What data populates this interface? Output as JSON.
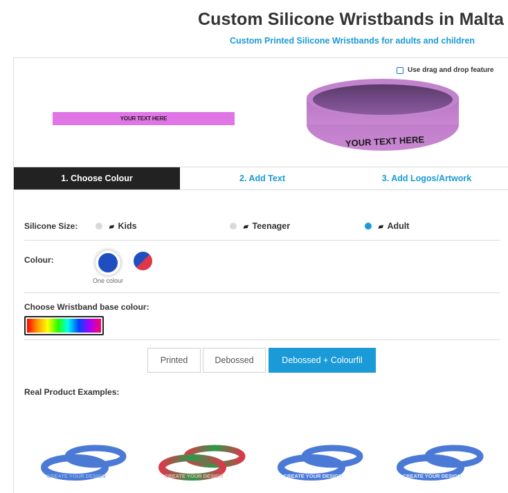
{
  "header": {
    "title": "Custom Silicone Wristbands in Malta",
    "subtitle": "Custom Printed Silicone Wristbands for adults and children"
  },
  "preview": {
    "drag_drop_label": "Use drag and drop feature",
    "drag_drop_checked": false,
    "flat_band_text": "YOUR TEXT HERE",
    "band_3d_text": "YOUR TEXT HERE",
    "band_colour": "#e075e6"
  },
  "tabs": [
    {
      "label": "1. Choose Colour",
      "active": true
    },
    {
      "label": "2. Add Text",
      "active": false
    },
    {
      "label": "3. Add Logos/Artwork",
      "active": false
    }
  ],
  "size": {
    "label": "Silicone Size:",
    "options": [
      {
        "label": "Kids",
        "selected": false
      },
      {
        "label": "Teenager",
        "selected": false
      },
      {
        "label": "Adult",
        "selected": true
      }
    ]
  },
  "colour": {
    "label": "Colour:",
    "one_colour_caption": "One colour",
    "selected": "one"
  },
  "base_colour": {
    "label": "Choose Wristband base colour:"
  },
  "style_buttons": [
    {
      "label": "Printed",
      "active": false
    },
    {
      "label": "Debossed",
      "active": false
    },
    {
      "label": "Debossed + Colourfil",
      "active": true
    }
  ],
  "examples": {
    "label": "Real Product Examples:",
    "band_text": "CREATE YOUR DESIGN"
  },
  "colors": {
    "accent": "#1a9ad6",
    "tab_active_bg": "#222222",
    "example_blue": "#4a7ad6",
    "example_red": "#d83a4a",
    "example_green": "#2a9a4a"
  }
}
